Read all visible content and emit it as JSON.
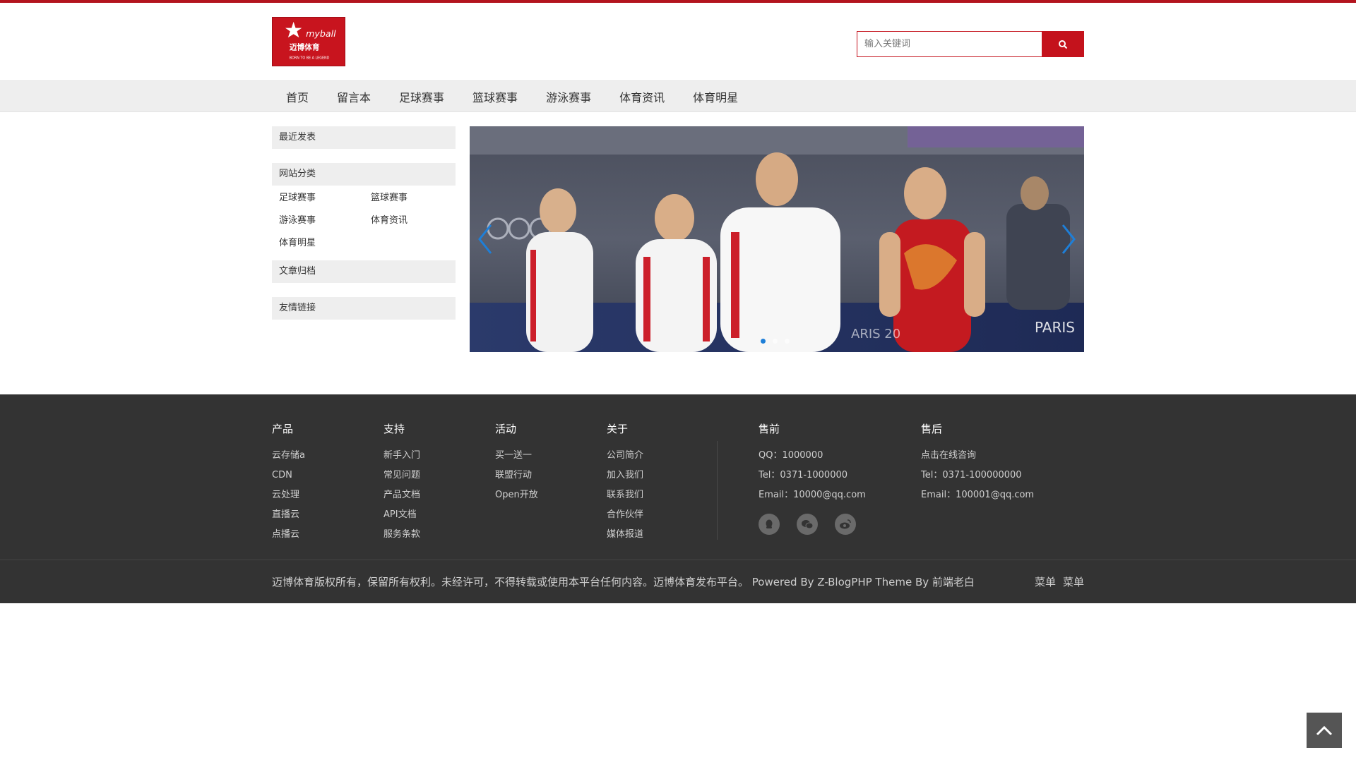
{
  "logo": {
    "brand": "myball",
    "cn": "迈博体育",
    "tagline": "BORN TO BE A LEGEND"
  },
  "search": {
    "placeholder": "输入关键词"
  },
  "nav": [
    "首页",
    "留言本",
    "足球赛事",
    "篮球赛事",
    "游泳赛事",
    "体育资讯",
    "体育明星"
  ],
  "sidebar": {
    "recent_title": "最近发表",
    "category_title": "网站分类",
    "categories": [
      "足球赛事",
      "篮球赛事",
      "游泳赛事",
      "体育资讯",
      "体育明星"
    ],
    "archive_title": "文章归档",
    "links_title": "友情链接"
  },
  "slider": {
    "dot_count": 3,
    "active_dot": 0
  },
  "footer": {
    "product": {
      "title": "产品",
      "items": [
        "云存储a",
        "CDN",
        "云处理",
        "直播云",
        "点播云"
      ]
    },
    "support": {
      "title": "支持",
      "items": [
        "新手入门",
        "常见问题",
        "产品文档",
        "API文档",
        "服务条款"
      ]
    },
    "activity": {
      "title": "活动",
      "items": [
        "买一送一",
        "联盟行动",
        "Open开放"
      ]
    },
    "about": {
      "title": "关于",
      "items": [
        "公司简介",
        "加入我们",
        "联系我们",
        "合作伙伴",
        "媒体报道"
      ]
    },
    "presale": {
      "title": "售前",
      "items": [
        "QQ：1000000",
        "Tel：0371-1000000",
        "Email：10000@qq.com"
      ]
    },
    "aftersale": {
      "title": "售后",
      "items": [
        "点击在线咨询",
        "Tel：0371-100000000",
        "Email：100001@qq.com"
      ]
    },
    "social_icons": [
      "qq-icon",
      "wechat-icon",
      "weibo-icon"
    ],
    "copyright": "迈博体育版权所有，保留所有权利。未经许可，不得转载或使用本平台任何内容。迈博体育发布平台。 Powered By Z-BlogPHP Theme By 前端老白",
    "menu_links": [
      "菜单",
      "菜单"
    ]
  },
  "colors": {
    "brand_red": "#c4121c",
    "footer_bg": "#333333",
    "nav_bg": "#eeeeee"
  }
}
